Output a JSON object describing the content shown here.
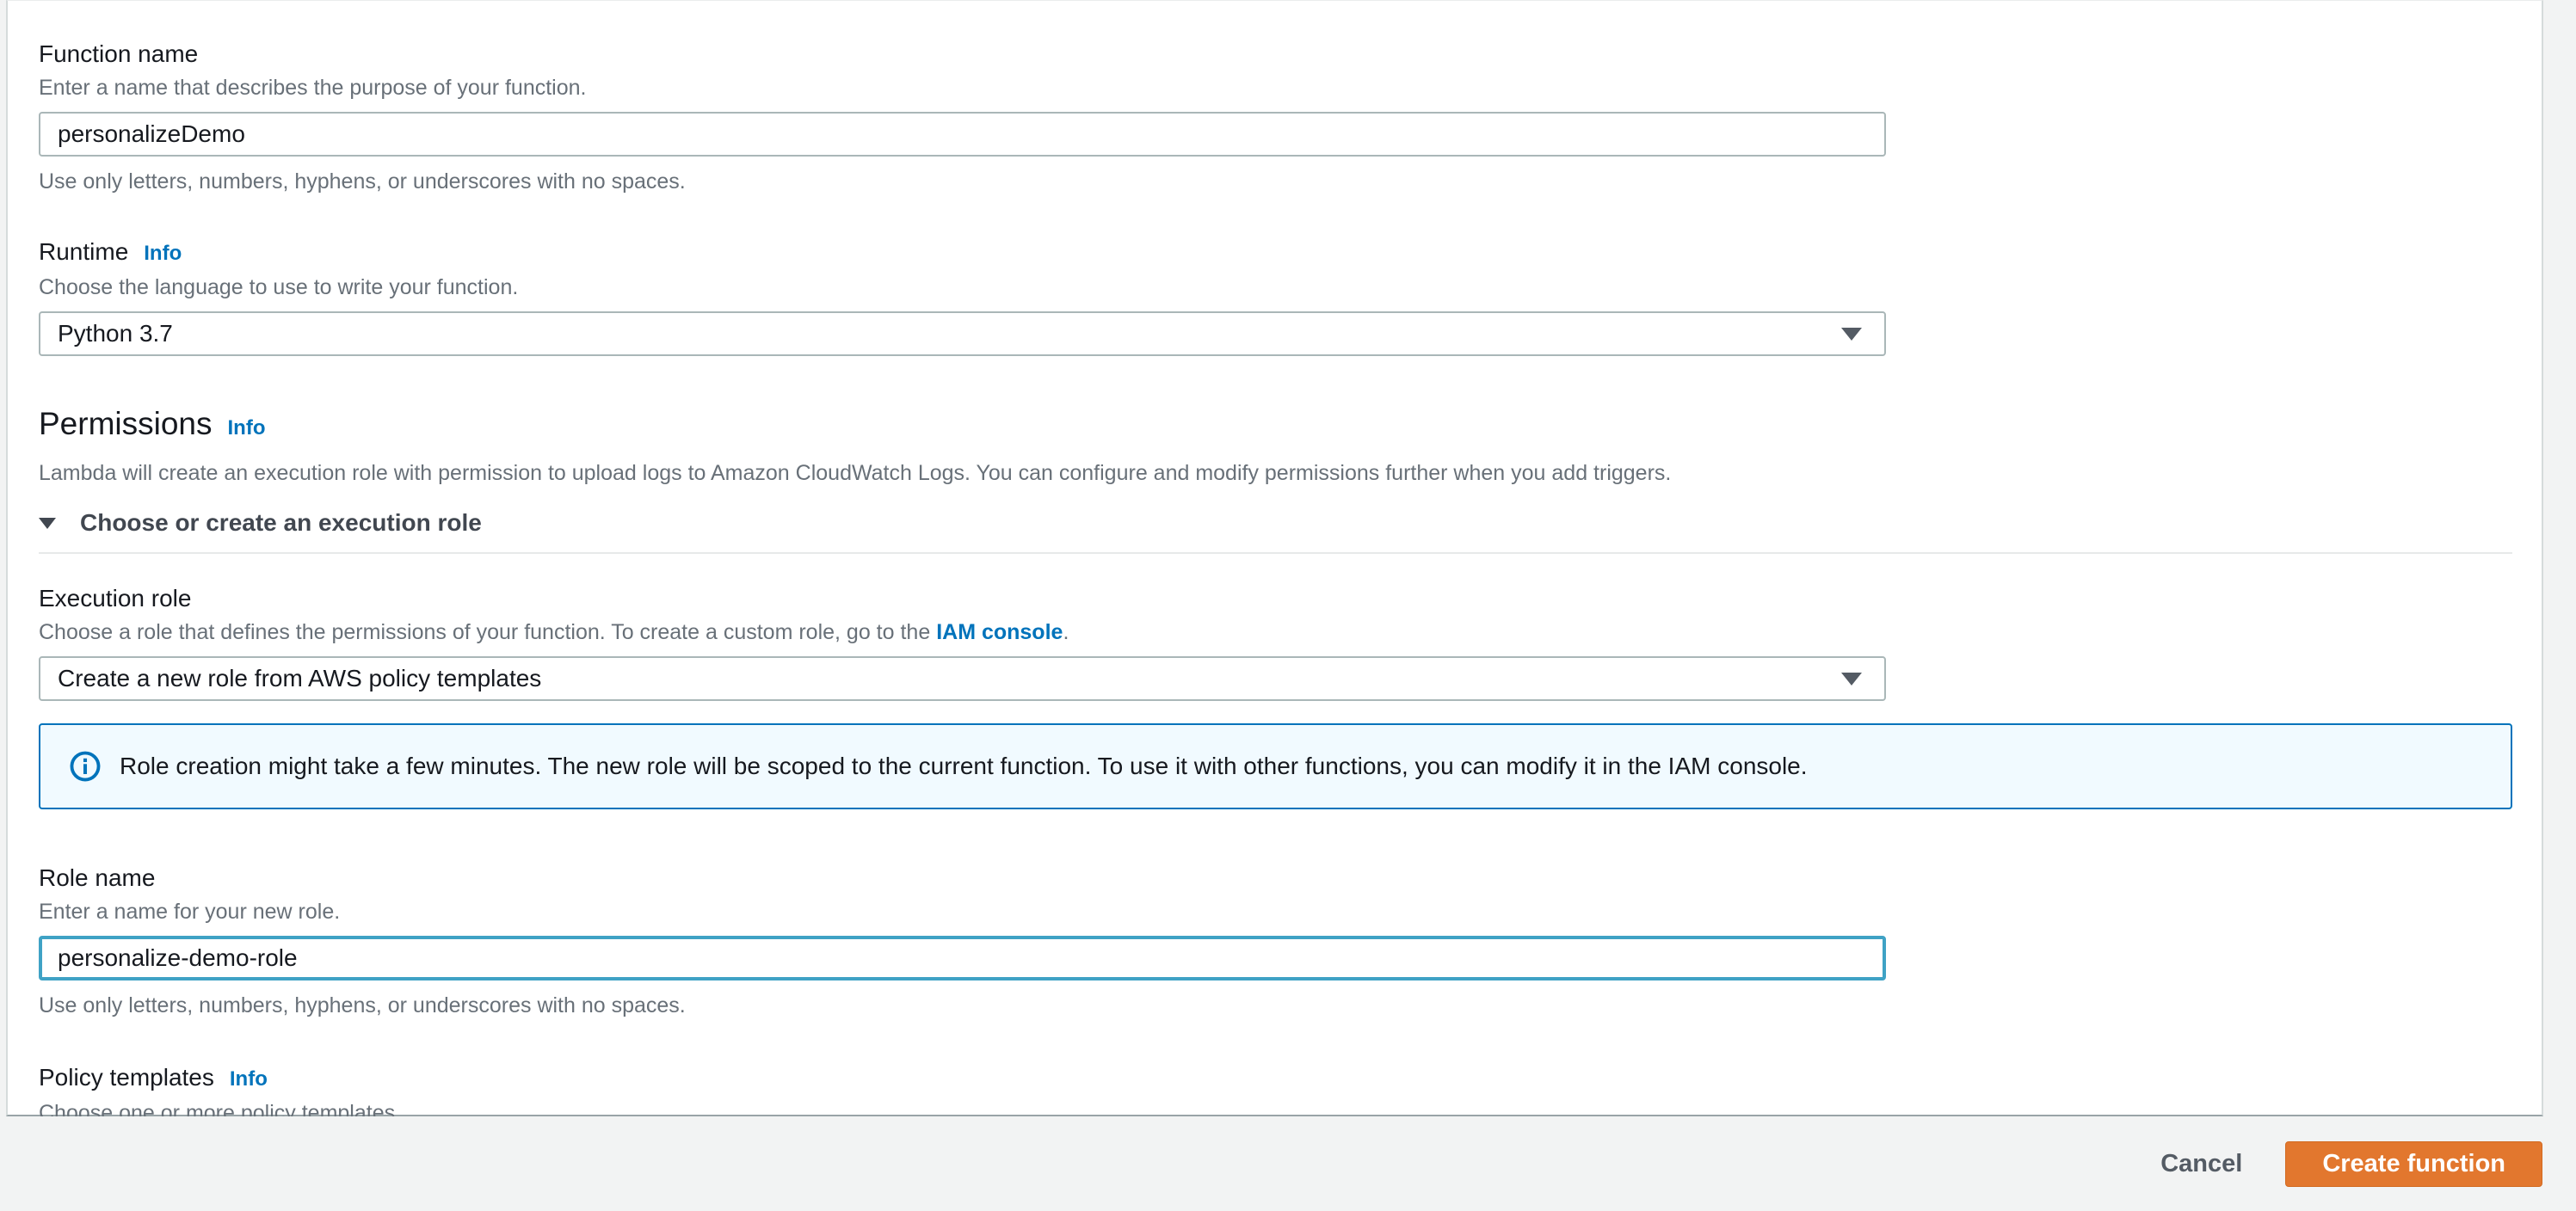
{
  "form": {
    "function_name": {
      "label": "Function name",
      "description": "Enter a name that describes the purpose of your function.",
      "value": "personalizeDemo",
      "helper": "Use only letters, numbers, hyphens, or underscores with no spaces."
    },
    "runtime": {
      "label": "Runtime",
      "info_label": "Info",
      "description": "Choose the language to use to write your function.",
      "value": "Python 3.7"
    },
    "permissions": {
      "heading": "Permissions",
      "info_label": "Info",
      "description": "Lambda will create an execution role with permission to upload logs to Amazon CloudWatch Logs. You can configure and modify permissions further when you add triggers.",
      "expander_label": "Choose or create an execution role"
    },
    "execution_role": {
      "label": "Execution role",
      "description_prefix": "Choose a role that defines the permissions of your function. To create a custom role, go to the ",
      "link_text": "IAM console",
      "description_suffix": ".",
      "value": "Create a new role from AWS policy templates"
    },
    "alert": {
      "text": "Role creation might take a few minutes. The new role will be scoped to the current function. To use it with other functions, you can modify it in the IAM console."
    },
    "role_name": {
      "label": "Role name",
      "description": "Enter a name for your new role.",
      "value": "personalize-demo-role",
      "helper": "Use only letters, numbers, hyphens, or underscores with no spaces."
    },
    "policy_templates": {
      "label": "Policy templates",
      "info_label": "Info",
      "description": "Choose one or more policy templates.",
      "value": ""
    }
  },
  "footer": {
    "cancel_label": "Cancel",
    "create_label": "Create function"
  },
  "colors": {
    "accent_orange": "#e2772e",
    "link_blue": "#0073bb",
    "focus_border": "#3fa2c5",
    "alert_bg": "#f1faff",
    "alert_border": "#0073bb"
  }
}
